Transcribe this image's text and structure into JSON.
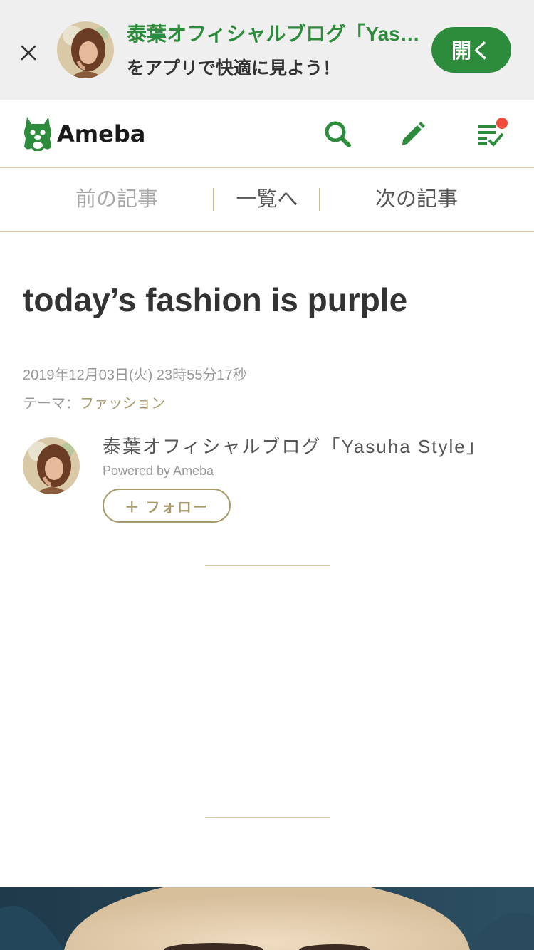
{
  "app_banner": {
    "title": "泰葉オフィシャルブログ「Yasuha Style」",
    "subtitle": "をアプリで快適に見よう！",
    "open_label": "開く"
  },
  "header": {
    "logo_text": "Ameba",
    "icons": [
      "search-icon",
      "pencil-icon",
      "checklist-icon"
    ],
    "has_notification": true
  },
  "article_nav": {
    "prev": "前の記事",
    "list": "一覧へ",
    "next": "次の記事"
  },
  "article": {
    "title": "today’s fashion is purple",
    "date": "2019年12月03日(火) 23時55分17秒",
    "theme_label": "テーマ：",
    "theme_value": "ファッション"
  },
  "author": {
    "blog_name": "泰葉オフィシャルブログ「Yasuha Style」",
    "powered_by": "Powered by Ameba",
    "follow_label": "＋ フォロー"
  },
  "colors": {
    "brand_green": "#2d8c3c",
    "accent_gold": "#a89a6b",
    "divider": "#d3c9a8",
    "notification": "#f04b3b"
  }
}
